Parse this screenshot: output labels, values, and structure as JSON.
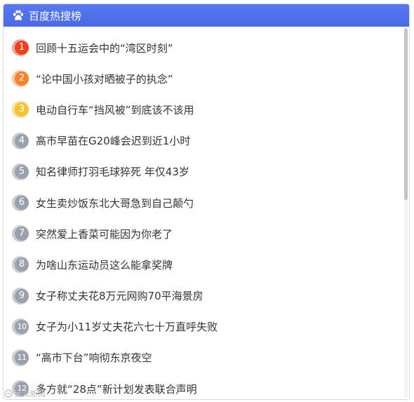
{
  "header": {
    "icon": "baidu-paw-icon",
    "title": "百度热搜榜",
    "accent_color": "#4e6ef2"
  },
  "items": [
    {
      "rank": "1",
      "title": "回顾十五运会中的“湾区时刻”"
    },
    {
      "rank": "2",
      "title": "“论中国小孩对晒被子的执念”"
    },
    {
      "rank": "3",
      "title": "电动自行车“挡风被”到底该不该用"
    },
    {
      "rank": "4",
      "title": "高市早苗在G20峰会迟到近1小时"
    },
    {
      "rank": "5",
      "title": "知名律师打羽毛球猝死 年仅43岁"
    },
    {
      "rank": "6",
      "title": "女生卖炒饭东北大哥急到自己颠勺"
    },
    {
      "rank": "7",
      "title": "突然爱上香菜可能因为你老了"
    },
    {
      "rank": "8",
      "title": "为啥山东运动员这么能拿奖牌"
    },
    {
      "rank": "9",
      "title": "女子称丈夫花8万元网购70平海景房"
    },
    {
      "rank": "10",
      "title": "女子为小11岁丈夫花六七十万直呼失败"
    },
    {
      "rank": "11",
      "title": "“高市下台”响彻东京夜空"
    },
    {
      "rank": "12",
      "title": "多方就“28点”新计划发表联合声明"
    }
  ],
  "colors": {
    "rank1": "#f2401d",
    "rank2": "#f7822a",
    "rank3": "#f5c232",
    "rank_other": "#9aa1ae"
  },
  "watermark": "大众新闻"
}
